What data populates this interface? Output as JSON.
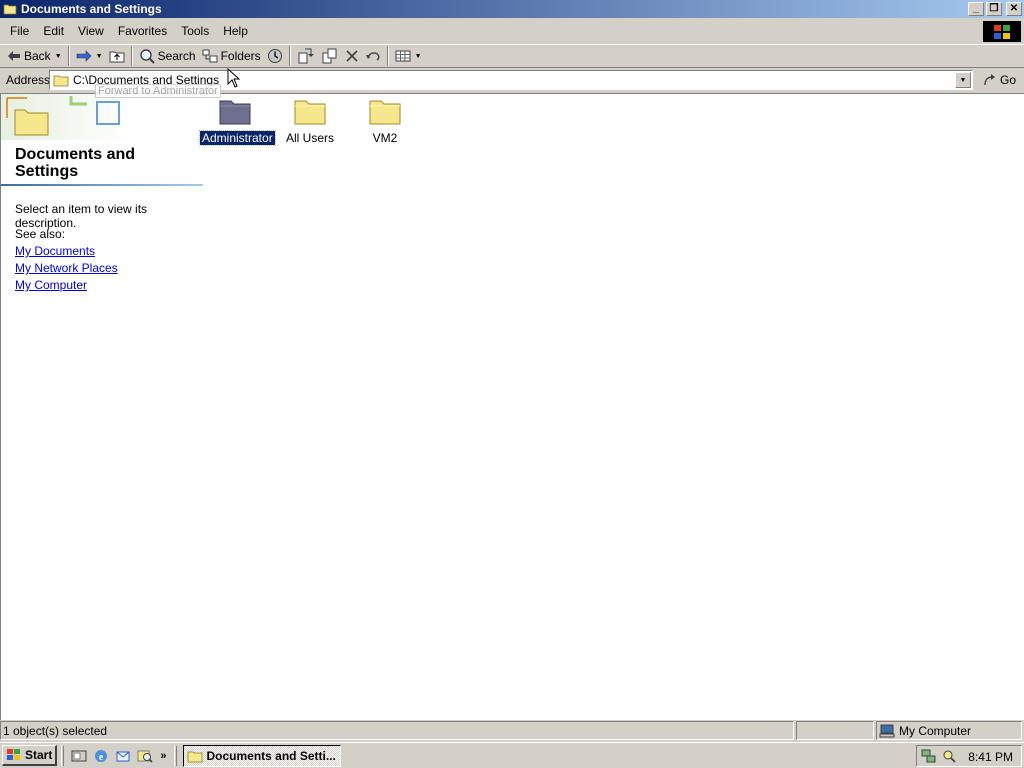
{
  "window": {
    "title": "Documents and Settings",
    "controls": {
      "minimize": "_",
      "restore": "❐",
      "close": "✕"
    }
  },
  "menu": [
    "File",
    "Edit",
    "View",
    "Favorites",
    "Tools",
    "Help"
  ],
  "toolbar": {
    "back_label": "Back",
    "search_label": "Search",
    "folders_label": "Folders"
  },
  "address": {
    "label": "Address",
    "value": "C:\\Documents and Settings",
    "go_label": "Go"
  },
  "tooltip": "Forward to Administrator",
  "left_pane": {
    "title": "Documents and Settings",
    "description": "Select an item to view its description.",
    "see_also_label": "See also:",
    "links": [
      "My Documents",
      "My Network Places",
      "My Computer"
    ]
  },
  "folders": [
    {
      "name": "Administrator",
      "selected": true
    },
    {
      "name": "All Users",
      "selected": false
    },
    {
      "name": "VM2",
      "selected": false
    }
  ],
  "status": {
    "selection": "1 object(s) selected",
    "zone": "My Computer"
  },
  "taskbar": {
    "start_label": "Start",
    "quick_launch_more": "»",
    "task_label": "Documents and Setti...",
    "clock": "8:41 PM"
  },
  "colors": {
    "title_gradient_start": "#0a246a",
    "title_gradient_end": "#a6caf0",
    "selection": "#0a246a",
    "link": "#0000ee",
    "folder": "#f5e88c",
    "folder_selected": "#6e6f8e"
  }
}
